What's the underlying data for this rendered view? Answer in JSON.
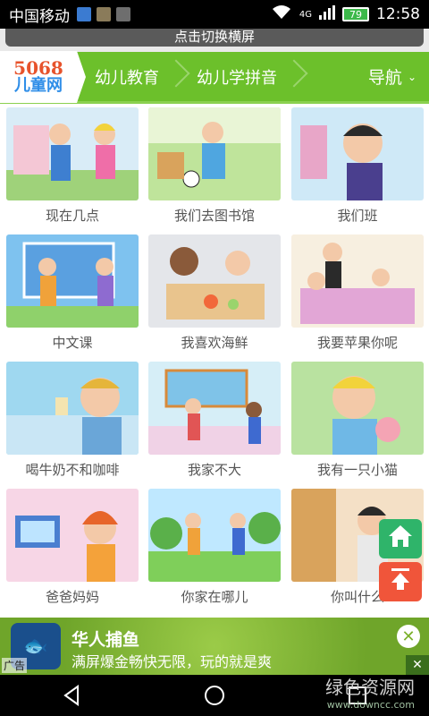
{
  "status": {
    "carrier": "中国移动",
    "network": "4G",
    "battery": "79",
    "time": "12:58"
  },
  "rotate": {
    "label": "点击切换横屏"
  },
  "nav": {
    "logo_number": "5068",
    "logo_text": "儿童网",
    "items": [
      "幼儿教育",
      "幼儿学拼音"
    ],
    "menu_label": "导航"
  },
  "lessons": [
    {
      "title": "现在几点"
    },
    {
      "title": "我们去图书馆"
    },
    {
      "title": "我们班"
    },
    {
      "title": "中文课"
    },
    {
      "title": "我喜欢海鲜"
    },
    {
      "title": "我要苹果你呢"
    },
    {
      "title": "喝牛奶不和咖啡"
    },
    {
      "title": "我家不大"
    },
    {
      "title": "我有一只小猫"
    },
    {
      "title": "爸爸妈妈"
    },
    {
      "title": "你家在哪儿"
    },
    {
      "title": "你叫什么"
    }
  ],
  "ad": {
    "title": "华人捕鱼",
    "subtitle": "满屏爆金畅快无限，玩的就是爽",
    "tag": "广告"
  },
  "watermark": {
    "name": "绿色资源网",
    "url": "www.downcc.com"
  },
  "colors": {
    "nav_green": "#6cc02b",
    "home_green": "#2fb46a",
    "up_red": "#f0553a"
  }
}
